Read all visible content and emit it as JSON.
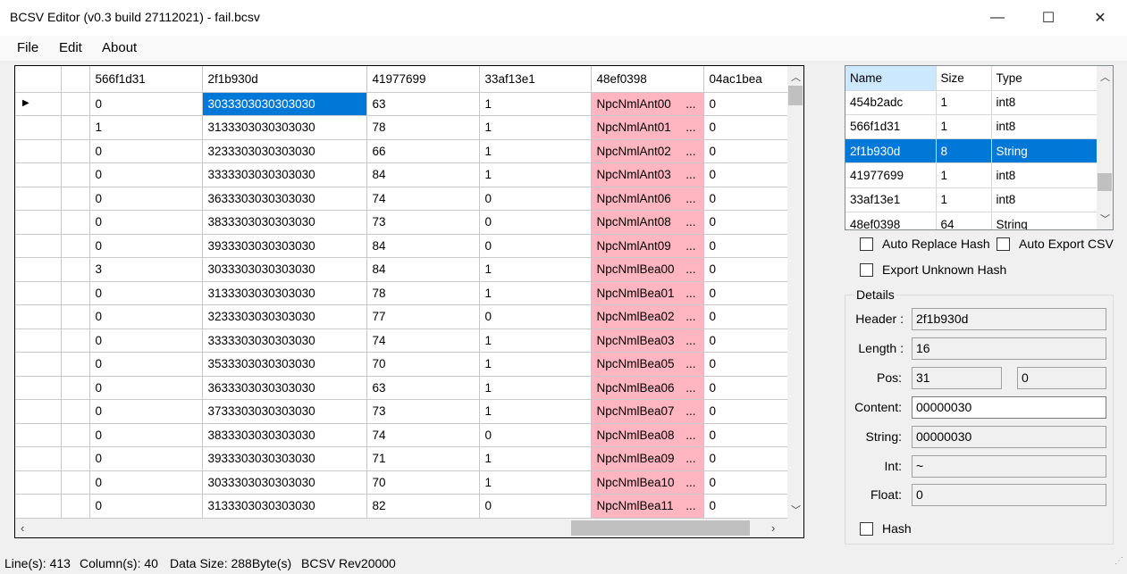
{
  "window": {
    "title": "BCSV Editor (v0.3 build 27112021) - fail.bcsv",
    "minimize": "—",
    "maximize": "☐",
    "close": "✕"
  },
  "menu": [
    "File",
    "Edit",
    "About"
  ],
  "grid": {
    "columns": [
      "",
      "",
      "566f1d31",
      "2f1b930d",
      "41977699",
      "33af13e1",
      "48ef0398",
      "04ac1bea"
    ],
    "rows": [
      [
        "",
        "0",
        "3033303030303030",
        "63",
        "1",
        "NpcNmlAnt00",
        "0"
      ],
      [
        "",
        "1",
        "3133303030303030",
        "78",
        "1",
        "NpcNmlAnt01",
        "0"
      ],
      [
        "",
        "0",
        "3233303030303030",
        "66",
        "1",
        "NpcNmlAnt02",
        "0"
      ],
      [
        "",
        "0",
        "3333303030303030",
        "84",
        "1",
        "NpcNmlAnt03",
        "0"
      ],
      [
        "",
        "0",
        "3633303030303030",
        "74",
        "0",
        "NpcNmlAnt06",
        "0"
      ],
      [
        "",
        "0",
        "3833303030303030",
        "73",
        "0",
        "NpcNmlAnt08",
        "0"
      ],
      [
        "",
        "0",
        "3933303030303030",
        "84",
        "0",
        "NpcNmlAnt09",
        "0"
      ],
      [
        "",
        "3",
        "3033303030303030",
        "84",
        "1",
        "NpcNmlBea00",
        "0"
      ],
      [
        "",
        "0",
        "3133303030303030",
        "78",
        "1",
        "NpcNmlBea01",
        "0"
      ],
      [
        "",
        "0",
        "3233303030303030",
        "77",
        "0",
        "NpcNmlBea02",
        "0"
      ],
      [
        "",
        "0",
        "3333303030303030",
        "74",
        "1",
        "NpcNmlBea03",
        "0"
      ],
      [
        "",
        "0",
        "3533303030303030",
        "70",
        "1",
        "NpcNmlBea05",
        "0"
      ],
      [
        "",
        "0",
        "3633303030303030",
        "63",
        "1",
        "NpcNmlBea06",
        "0"
      ],
      [
        "",
        "0",
        "3733303030303030",
        "73",
        "1",
        "NpcNmlBea07",
        "0"
      ],
      [
        "",
        "0",
        "3833303030303030",
        "74",
        "0",
        "NpcNmlBea08",
        "0"
      ],
      [
        "",
        "0",
        "3933303030303030",
        "71",
        "1",
        "NpcNmlBea09",
        "0"
      ],
      [
        "",
        "0",
        "3033303030303030",
        "70",
        "1",
        "NpcNmlBea10",
        "0"
      ],
      [
        "",
        "0",
        "3133303030303030",
        "82",
        "0",
        "NpcNmlBea11",
        "0"
      ]
    ],
    "current_row_marker": "▶",
    "ellipsis": "...",
    "highlight_color": "#ffb6c1",
    "selection_color": "#0078d7"
  },
  "fields_list": {
    "headers": [
      "Name",
      "Size",
      "Type"
    ],
    "rows": [
      [
        "454b2adc",
        "1",
        "int8"
      ],
      [
        "566f1d31",
        "1",
        "int8"
      ],
      [
        "2f1b930d",
        "8",
        "String"
      ],
      [
        "41977699",
        "1",
        "int8"
      ],
      [
        "33af13e1",
        "1",
        "int8"
      ],
      [
        "48ef0398",
        "64",
        "String"
      ]
    ],
    "selected_index": 2
  },
  "options": {
    "auto_replace_hash": "Auto Replace Hash",
    "auto_export_csv": "Auto Export CSV",
    "export_unknown_hash": "Export Unknown Hash"
  },
  "details": {
    "legend": "Details",
    "header_label": "Header :",
    "header_value": "2f1b930d",
    "length_label": "Length :",
    "length_value": "16",
    "pos_label": "Pos:",
    "pos_value": "31",
    "pos_value2": "0",
    "content_label": "Content:",
    "content_value": "00000030",
    "string_label": "String:",
    "string_value": "00000030",
    "int_label": "Int:",
    "int_value": "~",
    "float_label": "Float:",
    "float_value": "0",
    "hash_label": "Hash"
  },
  "status": {
    "lines": "Line(s): 413",
    "columns": "Column(s): 40",
    "data_size": "Data Size: 288Byte(s)",
    "rev": "BCSV Rev20000",
    "grip": "⋰"
  }
}
